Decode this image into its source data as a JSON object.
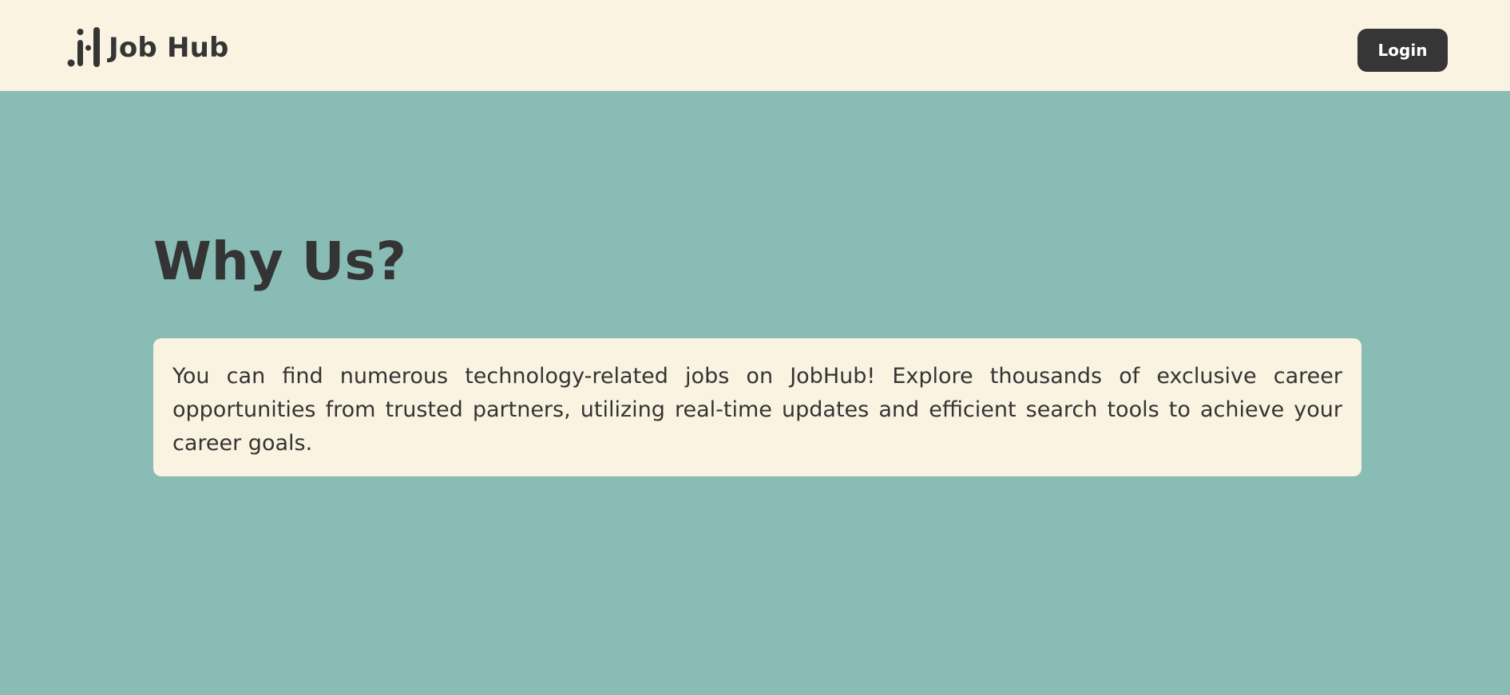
{
  "header": {
    "brand_name": "Job Hub",
    "logo_icon": "jobhub-logo-icon",
    "login_label": "Login"
  },
  "main": {
    "title": "Why Us?",
    "description": "You can find numerous technology-related jobs on JobHub! Explore thousands of exclusive career opportunities from trusted partners, utilizing real-time updates and efficient search tools to achieve your career goals."
  },
  "colors": {
    "header_bg": "#fbf3e1",
    "hero_bg": "#88bcb5",
    "text": "#343434",
    "button_bg": "#363636",
    "button_text": "#ffffff"
  }
}
